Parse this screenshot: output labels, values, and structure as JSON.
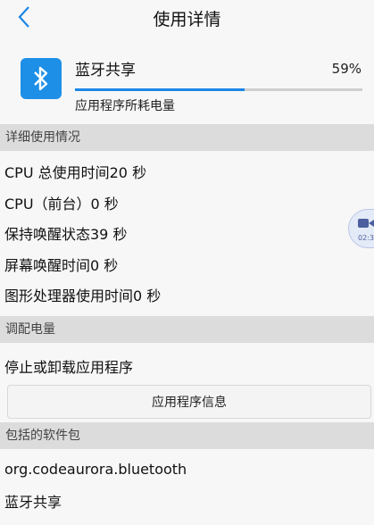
{
  "header": {
    "title": "使用详情",
    "back_icon": "chevron-left-icon"
  },
  "app": {
    "name": "蓝牙共享",
    "percent": "59%",
    "progress_fraction": 0.59,
    "subtitle": "应用程序所耗电量",
    "icon": "bluetooth-icon",
    "colors": {
      "icon_bg": "#1e8fe6",
      "bar_fill": "#1c86e8"
    }
  },
  "details": {
    "header": "详细使用情况",
    "rows": [
      "CPU 总使用时间20 秒",
      "CPU（前台）0 秒",
      "保持唤醒状态39 秒",
      "屏幕唤醒时间0 秒",
      "图形处理器使用时间0 秒"
    ]
  },
  "adjust": {
    "header": "调配电量",
    "stop_label": "停止或卸载应用程序",
    "info_button": "应用程序信息"
  },
  "packages": {
    "header": "包括的软件包",
    "items": [
      "org.codeaurora.bluetooth",
      "蓝牙共享"
    ]
  },
  "floating": {
    "time": "02:3",
    "icon": "video-camera-icon"
  }
}
